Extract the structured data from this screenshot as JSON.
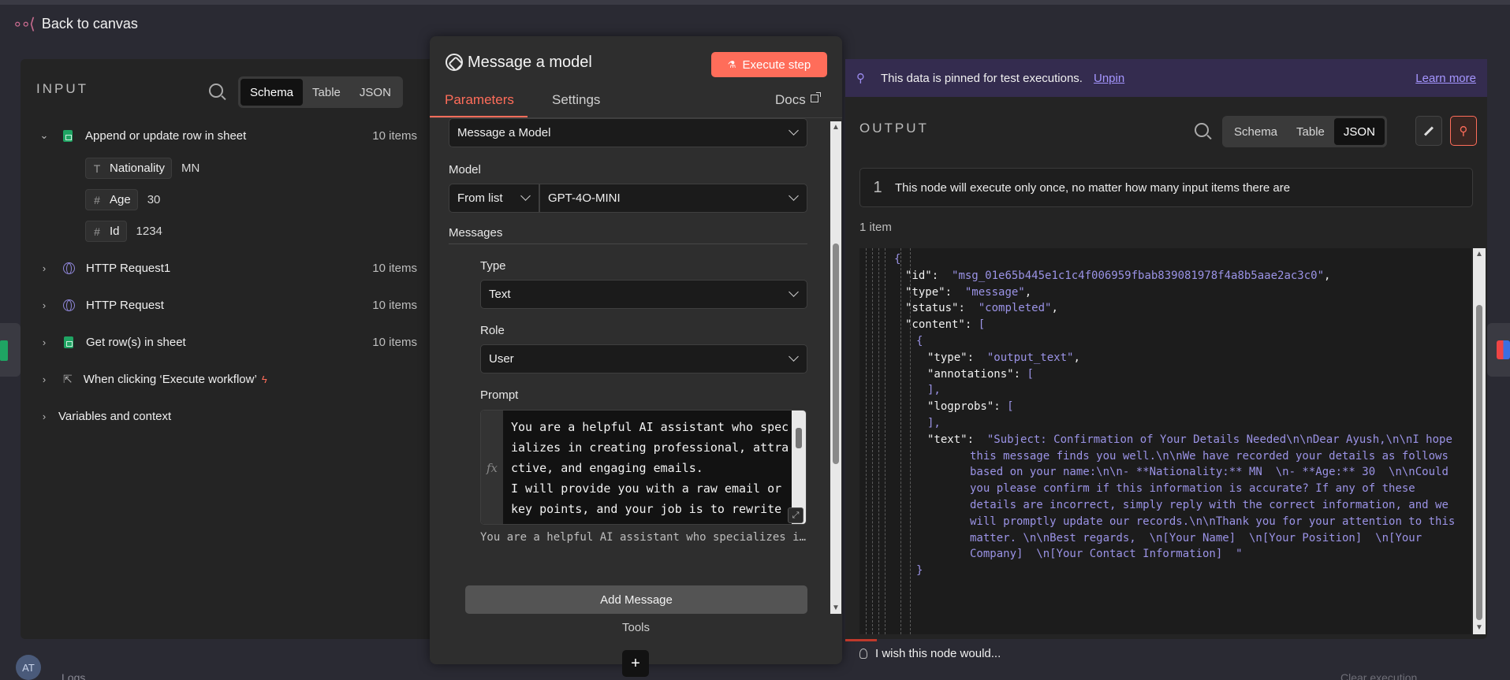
{
  "canvas": {
    "back_label": "Back to canvas",
    "avatar_initials": "AT",
    "logs_label": "Logs",
    "clear_execution": "Clear execution"
  },
  "input": {
    "title": "INPUT",
    "tabs": [
      "Schema",
      "Table",
      "JSON"
    ],
    "active_tab": "Schema",
    "tree": [
      {
        "label": "Append or update row in sheet",
        "count": "10 items",
        "icon": "google-sheets-icon",
        "expanded": true
      },
      {
        "label": "HTTP Request1",
        "count": "10 items",
        "icon": "globe-icon"
      },
      {
        "label": "HTTP Request",
        "count": "10 items",
        "icon": "globe-icon"
      },
      {
        "label": "Get row(s) in sheet",
        "count": "10 items",
        "icon": "google-sheets-icon"
      },
      {
        "label": "When clicking ‘Execute workflow’",
        "icon": "cursor-click-icon"
      },
      {
        "label": "Variables and context"
      }
    ],
    "fields": [
      {
        "type_icon": "T",
        "name": "Nationality",
        "value": "MN"
      },
      {
        "type_icon": "#",
        "name": "Age",
        "value": "30"
      },
      {
        "type_icon": "#",
        "name": "Id",
        "value": "1234"
      }
    ]
  },
  "node": {
    "title": "Message a model",
    "execute_label": "Execute step",
    "tabs": [
      "Parameters",
      "Settings"
    ],
    "active_tab": "Parameters",
    "docs_label": "Docs",
    "operation": "Message a Model",
    "model_label": "Model",
    "model_mode": "From list",
    "model_value": "GPT-4O-MINI",
    "messages_label": "Messages",
    "type_label": "Type",
    "type_value": "Text",
    "role_label": "Role",
    "role_value": "User",
    "prompt_label": "Prompt",
    "prompt_fx": "fx",
    "prompt_text": "You are a helpful AI assistant who specializes in creating professional, attractive, and engaging emails.\nI will provide you with a raw email or key points, and your job is to rewrite it in a clear, persuasive, and polishe",
    "prompt_preview": "You are a helpful AI assistant who specializes in...",
    "add_message_label": "Add Message",
    "tools_label": "Tools",
    "plus_label": "+"
  },
  "output": {
    "pin_message": "This data is pinned for test executions.",
    "unpin_label": "Unpin",
    "learn_more_label": "Learn more",
    "title": "OUTPUT",
    "tabs": [
      "Schema",
      "Table",
      "JSON"
    ],
    "active_tab": "JSON",
    "notice_number": "1",
    "notice_text": "This node will execute only once, no matter how many input items there are",
    "item_count": "1 item",
    "json_lines": [
      {
        "indent": 0,
        "tokens": [
          [
            "p",
            "{"
          ]
        ]
      },
      {
        "indent": 1,
        "tokens": [
          [
            "k",
            "\"id\""
          ],
          [
            "x",
            ":  "
          ],
          [
            "s",
            "\"msg_01e65b445e1c1c4f006959fbab839081978f4a8b5aae2ac3c0\""
          ],
          [
            "x",
            ","
          ]
        ]
      },
      {
        "indent": 1,
        "tokens": [
          [
            "k",
            "\"type\""
          ],
          [
            "x",
            ":  "
          ],
          [
            "s",
            "\"message\""
          ],
          [
            "x",
            ","
          ]
        ]
      },
      {
        "indent": 1,
        "tokens": [
          [
            "k",
            "\"status\""
          ],
          [
            "x",
            ":  "
          ],
          [
            "s",
            "\"completed\""
          ],
          [
            "x",
            ","
          ]
        ]
      },
      {
        "indent": 1,
        "tokens": [
          [
            "k",
            "\"content\""
          ],
          [
            "x",
            ": "
          ],
          [
            "p",
            "["
          ]
        ]
      },
      {
        "indent": 2,
        "tokens": [
          [
            "p",
            "{"
          ]
        ]
      },
      {
        "indent": 3,
        "tokens": [
          [
            "k",
            "\"type\""
          ],
          [
            "x",
            ":  "
          ],
          [
            "s",
            "\"output_text\""
          ],
          [
            "x",
            ","
          ]
        ]
      },
      {
        "indent": 3,
        "tokens": [
          [
            "k",
            "\"annotations\""
          ],
          [
            "x",
            ": "
          ],
          [
            "p",
            "["
          ]
        ]
      },
      {
        "indent": 3,
        "tokens": [
          [
            "p",
            "],"
          ]
        ]
      },
      {
        "indent": 3,
        "tokens": [
          [
            "k",
            "\"logprobs\""
          ],
          [
            "x",
            ": "
          ],
          [
            "p",
            "["
          ]
        ]
      },
      {
        "indent": 3,
        "tokens": [
          [
            "p",
            "],"
          ]
        ]
      },
      {
        "indent": 3,
        "tokens": [
          [
            "k",
            "\"text\""
          ],
          [
            "x",
            ":  "
          ],
          [
            "s",
            "\"Subject: Confirmation of Your Details Needed\\n\\nDear Ayush,\\n\\nI hope"
          ]
        ]
      },
      {
        "indent": 4,
        "tokens": [
          [
            "s",
            "this message finds you well.\\n\\nWe have recorded your details as follows"
          ]
        ]
      },
      {
        "indent": 4,
        "tokens": [
          [
            "s",
            "based on your name:\\n\\n- **Nationality:** MN  \\n- **Age:** 30  \\n\\nCould"
          ]
        ]
      },
      {
        "indent": 4,
        "tokens": [
          [
            "s",
            "you please confirm if this information is accurate? If any of these"
          ]
        ]
      },
      {
        "indent": 4,
        "tokens": [
          [
            "s",
            "details are incorrect, simply reply with the correct information, and we"
          ]
        ]
      },
      {
        "indent": 4,
        "tokens": [
          [
            "s",
            "will promptly update our records.\\n\\nThank you for your attention to this"
          ]
        ]
      },
      {
        "indent": 4,
        "tokens": [
          [
            "s",
            "matter. \\n\\nBest regards,  \\n[Your Name]  \\n[Your Position]  \\n[Your"
          ]
        ]
      },
      {
        "indent": 4,
        "tokens": [
          [
            "s",
            "Company]  \\n[Your Contact Information]  \""
          ]
        ]
      },
      {
        "indent": 2,
        "tokens": [
          [
            "p",
            "}"
          ]
        ]
      }
    ],
    "wish_label": "I wish this node would..."
  },
  "colors": {
    "accent": "#ff6d5a",
    "pin_banner": "#342c4f",
    "json_string": "#9b93e6",
    "sheets_green": "#1fa463"
  }
}
